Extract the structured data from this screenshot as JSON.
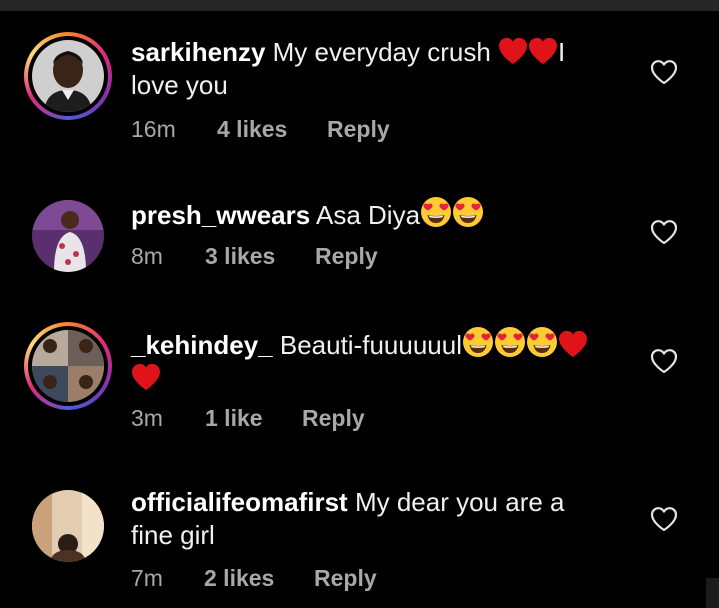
{
  "comments": [
    {
      "username": "sarkihenzy",
      "text_before": " My everyday crush ",
      "text_after": "I love you",
      "hearts_after": 2,
      "time": "16m",
      "likes": "4 likes",
      "reply": "Reply",
      "story_ring": true
    },
    {
      "username": "presh_wwears",
      "text_before": " Asa Diya",
      "smiley_hearts": 2,
      "time": "8m",
      "likes": "3 likes",
      "reply": "Reply",
      "story_ring": false
    },
    {
      "username": "_kehindey_",
      "text_before": " Beauti-fuuuuuul",
      "smiley_hearts": 3,
      "red_hearts": 2,
      "time": "3m",
      "likes": "1 like",
      "reply": "Reply",
      "story_ring": true
    },
    {
      "username": "officialifeomafirst",
      "text_before": " My dear you are a fine girl",
      "time": "7m",
      "likes": "2 likes",
      "reply": "Reply",
      "story_ring": false
    }
  ],
  "icons": {
    "like": "heart-outline-icon",
    "emoji_red_heart": "red-heart-emoji",
    "emoji_heart_eyes": "heart-eyes-emoji"
  },
  "colors": {
    "background": "#000000",
    "meta_text": "#a8a8a8",
    "heart_red": "#e0131b",
    "emoji_yellow": "#ffcc33"
  }
}
